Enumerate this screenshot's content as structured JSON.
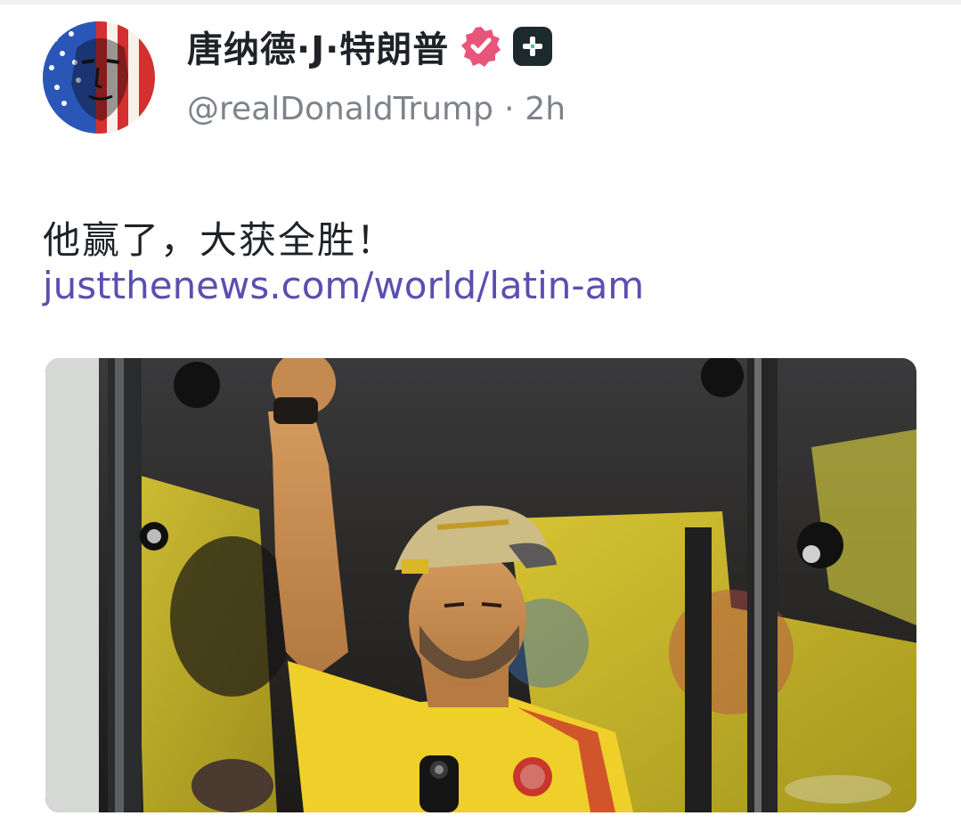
{
  "post": {
    "author": {
      "display_name": "唐纳德·J·特朗普",
      "handle": "@realDonaldTrump",
      "separator": "·",
      "time_ago": "2h",
      "avatar_icon": "flag-portrait-avatar",
      "verified_icon": "verified-badge-icon",
      "follow_icon": "plus-follow-icon"
    },
    "text": "他赢了，大获全胜！",
    "link": "justthenews.com/world/latin-am",
    "media": {
      "kind": "photo",
      "icon": "photo-man-raised-fist-yellow-jersey"
    }
  },
  "colors": {
    "name": "#1f2328",
    "handle": "#7d838b",
    "link": "#5a4fb0",
    "verified": "#e8557a",
    "follow_bg": "#1d2a2d",
    "jersey": "#f2d22c"
  }
}
